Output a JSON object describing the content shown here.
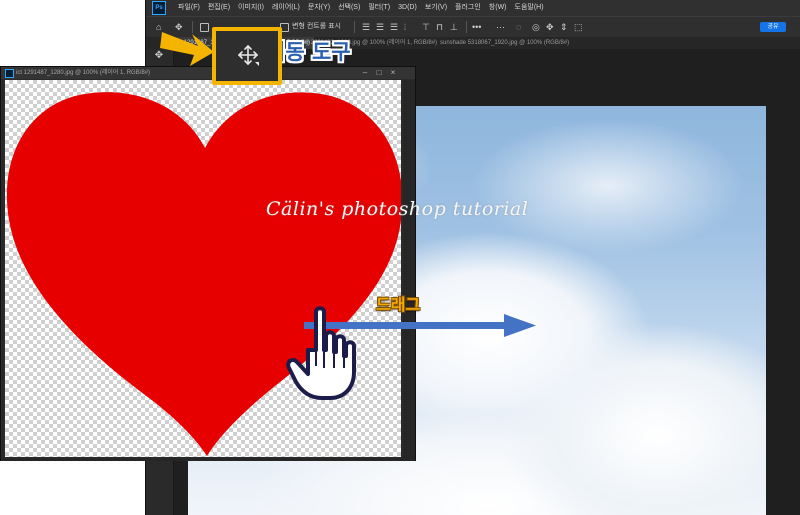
{
  "app": {
    "logo_text": "Ps",
    "menus": [
      "파일(F)",
      "편집(E)",
      "이미지(I)",
      "레이어(L)",
      "문자(Y)",
      "선택(S)",
      "필터(T)",
      "3D(D)",
      "보기(V)",
      "플러그인",
      "창(W)",
      "도움말(H)"
    ]
  },
  "options_bar": {
    "show_transform_label": "변형 컨트롤 표시",
    "share_label": "공유"
  },
  "tabs": [
    {
      "label": "ict 1291487_1280.jpg @ 100% (레이어 1, RGB/8#)",
      "active": true
    },
    {
      "label": "sky 2291482_1280.jpg @ 100% (레이어 1, RGB/8#)",
      "active": false
    },
    {
      "label": "sunshade 5318067_1920.jpg @ 100% (RGB/8#)",
      "active": false
    }
  ],
  "heart_window": {
    "title": "ict 1291487_1280.jpg @ 100% (레이어 1, RGB/8#)",
    "heart_color": "#e60000",
    "window_controls": [
      "–",
      "□",
      "×"
    ]
  },
  "annotations": {
    "tool_label": "이동 도구",
    "drag_label": "드래그",
    "highlight_color": "#f5b400",
    "arrow_color": "#4472c4",
    "tool_label_color": "#2b5fb0"
  },
  "watermark": "Cälin's photoshop tutorial",
  "icons": {
    "home": "home-icon",
    "move": "move-tool-icon",
    "pointer": "hand-pointer-icon",
    "drag_arrow": "arrow-right-icon"
  }
}
